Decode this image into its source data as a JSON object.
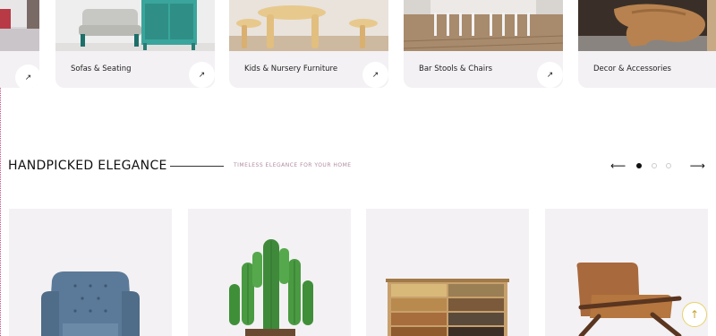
{
  "categories": {
    "items": [
      {
        "label": "Sofas & Seating",
        "icon": "arrow-up-right-icon"
      },
      {
        "label": "Kids & Nursery Furniture",
        "icon": "arrow-up-right-icon"
      },
      {
        "label": "Bar Stools & Chairs",
        "icon": "arrow-up-right-icon"
      },
      {
        "label": "Decor & Accessories",
        "icon": "arrow-up-right-icon"
      }
    ],
    "arrow_glyph": "↗"
  },
  "section": {
    "title": "HANDPICKED ELEGANCE",
    "subtitle": "TIMELESS ELEGANCE FOR YOUR HOME"
  },
  "carousel": {
    "prev_glyph": "⟵",
    "next_glyph": "⟶",
    "dots": 3,
    "active_dot": 1
  },
  "products": [
    {
      "name": "armchair-image"
    },
    {
      "name": "cactus-image"
    },
    {
      "name": "sideboard-image"
    },
    {
      "name": "lounge-chair-image"
    }
  ],
  "scroll_top": {
    "glyph": "↑",
    "icon": "arrow-up-icon"
  },
  "colors": {
    "card_bg": "#f3f1f3",
    "accent_pink": "#b08aa0",
    "accent_gold": "#c9a227"
  }
}
